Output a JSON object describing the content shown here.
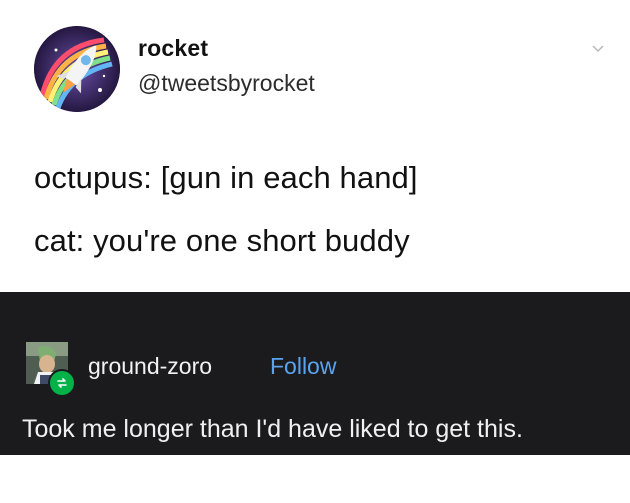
{
  "tweet": {
    "display_name": "rocket",
    "handle": "@tweetsbyrocket",
    "lines": [
      "octupus: [gun in each hand]",
      "cat: you're one short buddy"
    ],
    "avatar_icon": "rocket-rainbow-avatar",
    "menu_icon": "chevron-down-icon"
  },
  "reply": {
    "username": "ground-zoro",
    "follow_label": "Follow",
    "text": "Took me longer than I'd have liked to get this.",
    "badge_icon": "reblog-icon",
    "colors": {
      "background": "#1b1b1d",
      "follow": "#5aa3f0",
      "badge": "#00b248"
    }
  }
}
